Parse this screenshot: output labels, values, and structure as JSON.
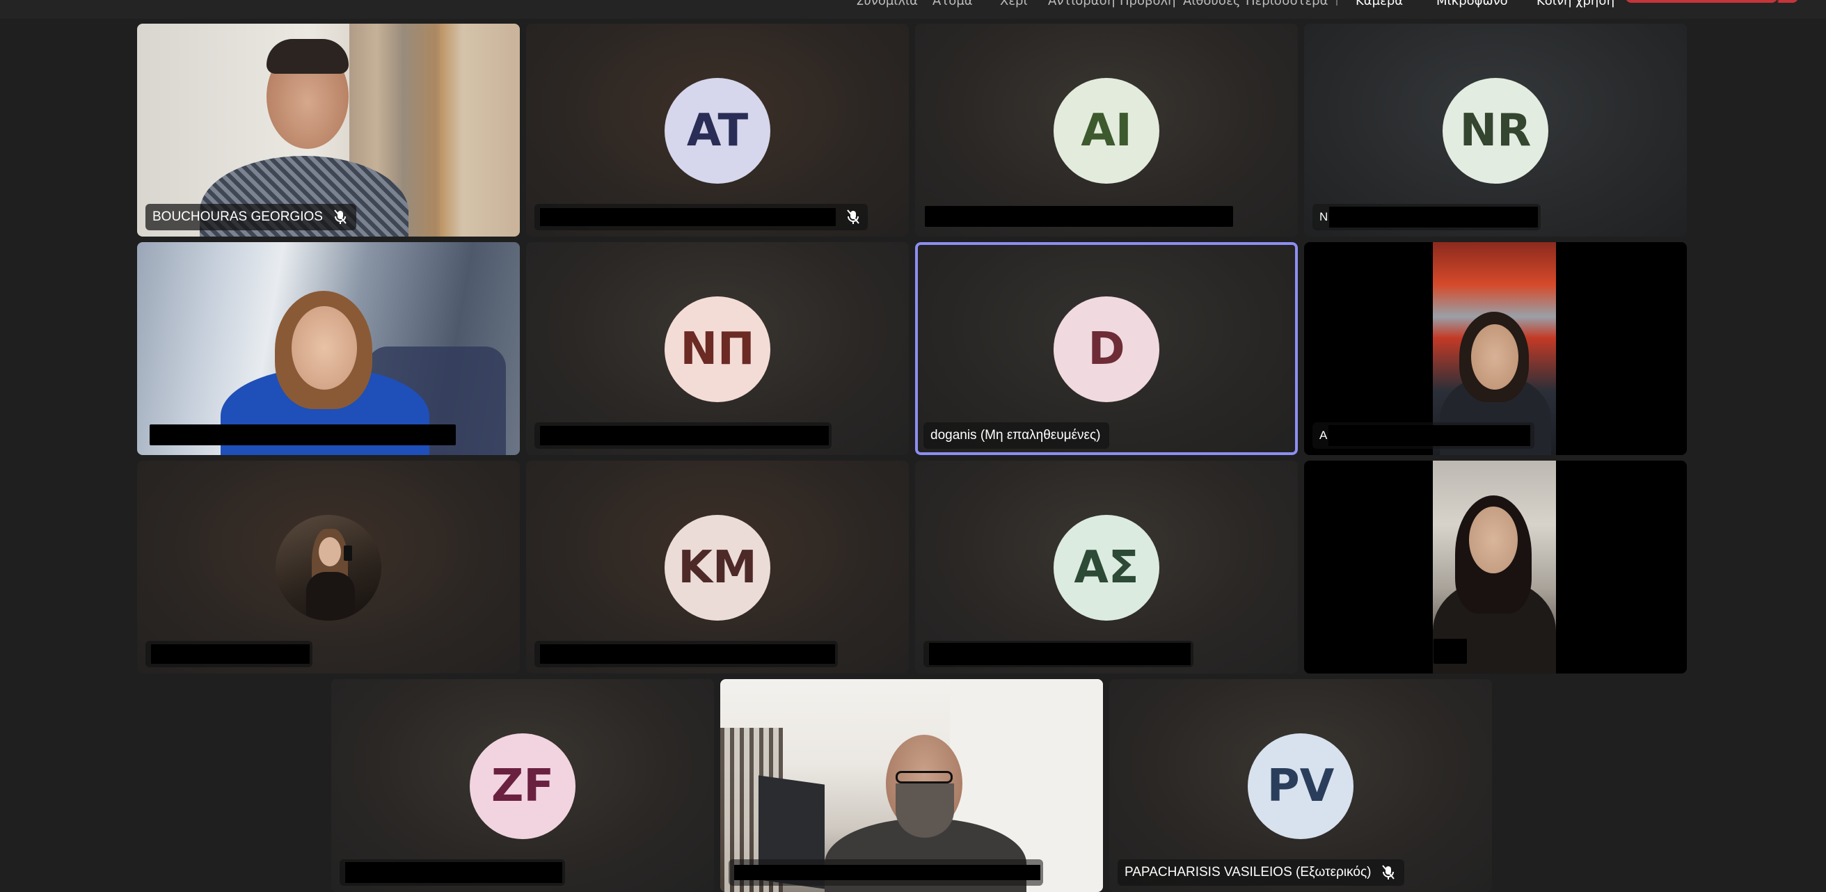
{
  "toolbar": {
    "items": [
      "Συνομιλία",
      "Άτομα",
      "Χέρι",
      "Αντίδραση",
      "Προβολή",
      "Αίθουσες",
      "Περισσότερα",
      "Κάμερα",
      "Μικρόφωνο",
      "Κοινή χρήση"
    ]
  },
  "colors": {
    "active_border": "#8d8ef2",
    "leave_button": "#c4353a",
    "background": "#1f1f1f"
  },
  "participants": [
    {
      "name": "BOUCHOURAS GEORGIOS",
      "type": "video",
      "muted": true
    },
    {
      "initials": "AT",
      "avatar_bg": "#d6d6ec",
      "avatar_fg": "#2a2d55",
      "muted": true
    },
    {
      "initials": "AI",
      "avatar_bg": "#e3ecdc",
      "avatar_fg": "#3d5a2e"
    },
    {
      "initials": "NR",
      "avatar_bg": "#e3ece0",
      "avatar_fg": "#344530",
      "label_prefix": "N"
    },
    {
      "type": "video"
    },
    {
      "initials": "ΝΠ",
      "avatar_bg": "#f4dcd6",
      "avatar_fg": "#6b2a24"
    },
    {
      "initials": "D",
      "avatar_bg": "#f0dadf",
      "avatar_fg": "#6e2c37",
      "name": "doganis (Μη επαληθευμένες)",
      "active": true
    },
    {
      "type": "video",
      "label_prefix": "A"
    },
    {
      "type": "photo-avatar"
    },
    {
      "initials": "ΚΜ",
      "avatar_bg": "#ecdcd8",
      "avatar_fg": "#4d2a28"
    },
    {
      "initials": "ΑΣ",
      "avatar_bg": "#dcebe0",
      "avatar_fg": "#2c4a36"
    },
    {
      "type": "video"
    },
    {
      "initials": "ZF",
      "avatar_bg": "#f2d4e0",
      "avatar_fg": "#6a2140"
    },
    {
      "type": "video"
    },
    {
      "initials": "PV",
      "avatar_bg": "#d8e2ee",
      "avatar_fg": "#2a3e5c",
      "name": "PAPACHARISIS VASILEIOS (Εξωτερικός)",
      "muted": true
    }
  ]
}
